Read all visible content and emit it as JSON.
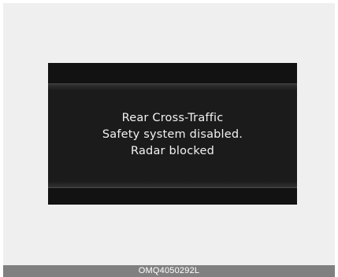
{
  "display": {
    "message_lines": [
      "Rear Cross-Traffic",
      "Safety system disabled.",
      "Radar blocked"
    ]
  },
  "caption": {
    "code": "OMQ4050292L"
  },
  "colors": {
    "page_background": "#efefef",
    "display_background": "#1b1b1b",
    "display_text": "#f2f2f2",
    "caption_background": "#808080",
    "caption_text": "#ffffff"
  }
}
